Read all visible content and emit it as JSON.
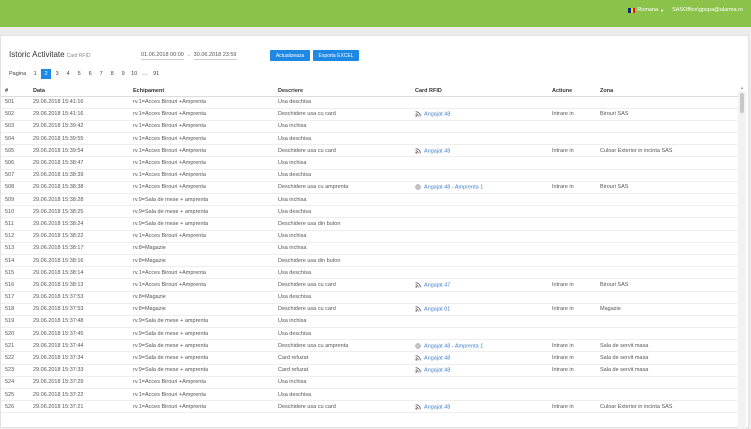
{
  "topbar": {
    "language": "Romana",
    "user": "SASOffice\\gpopa@alarma.ro",
    "flag_colors": [
      "#002B7F",
      "#FCD116",
      "#CE1126"
    ]
  },
  "header": {
    "title": "Istoric Activitate",
    "subtitle": "Card RFID"
  },
  "filters": {
    "date_from": "01.06.2018 00:00",
    "separator": "-",
    "date_to": "30.06.2018 23:59"
  },
  "buttons": {
    "refresh": "Actualizeaza",
    "export": "Exporta EXCEL"
  },
  "pager": {
    "label": "Pagina",
    "pages": [
      "1",
      "2",
      "3",
      "4",
      "5",
      "6",
      "7",
      "8",
      "9",
      "10",
      "...",
      "91"
    ],
    "active_index": 1
  },
  "table": {
    "headers": [
      "#",
      "Data",
      "Echipament",
      "Descriere",
      "Card RFID",
      "Actiune",
      "Zona"
    ],
    "rows": [
      [
        "501",
        "29.06.2018 15:41:16",
        "rv.1=Acces Birouri +Amprenta",
        "Usa deschisa",
        "",
        "",
        ""
      ],
      [
        "502",
        "29.06.2018 15:41:16",
        "rv.1=Acces Birouri +Amprenta",
        "Deschidere usa cu card",
        "Angajat 48",
        "Intrare in",
        "Birouri SAS"
      ],
      [
        "503",
        "29.06.2018 15:39:42",
        "rv.1=Acces Birouri +Amprenta",
        "Usa inchisa",
        "",
        "",
        ""
      ],
      [
        "504",
        "29.06.2018 15:39:55",
        "rv.1=Acces Birouri +Amprenta",
        "Usa deschisa",
        "",
        "",
        ""
      ],
      [
        "505",
        "29.06.2018 15:39:54",
        "rv.1=Acces Birouri +Amprenta",
        "Deschidere usa cu card",
        "Angajat 48",
        "Intrare in",
        "Culoar Exterior in incinta SAS"
      ],
      [
        "506",
        "29.06.2018 15:38:47",
        "rv.1=Acces Birouri +Amprenta",
        "Usa inchisa",
        "",
        "",
        ""
      ],
      [
        "507",
        "29.06.2018 15:38:39",
        "rv.1=Acces Birouri +Amprenta",
        "Usa deschisa",
        "",
        "",
        ""
      ],
      [
        "508",
        "29.06.2018 15:38:38",
        "rv.1=Acces Birouri +Amprenta",
        "Deschidere usa cu amprenta",
        "Angajat 48 - Amprenta 1",
        "Intrare in",
        "Birouri SAS"
      ],
      [
        "509",
        "29.06.2018 15:38:28",
        "rv.9=Sala de mese + amprenta",
        "Usa inchisa",
        "",
        "",
        ""
      ],
      [
        "510",
        "29.06.2018 15:38:25",
        "rv.9=Sala de mese + amprenta",
        "Usa deschisa",
        "",
        "",
        ""
      ],
      [
        "511",
        "29.06.2018 15:38:24",
        "rv.9=Sala de mese + amprenta",
        "Deschidere usa din buton",
        "",
        "",
        ""
      ],
      [
        "512",
        "29.06.2018 15:38:22",
        "rv.1=Acces Birouri +Amprenta",
        "Usa inchisa",
        "",
        "",
        ""
      ],
      [
        "513",
        "29.06.2018 15:38:17",
        "rv.8=Magazie",
        "Usa inchisa",
        "",
        "",
        ""
      ],
      [
        "514",
        "29.06.2018 15:38:16",
        "rv.8=Magazie",
        "Deschidere usa din buton",
        "",
        "",
        ""
      ],
      [
        "515",
        "29.06.2018 15:38:14",
        "rv.1=Acces Birouri +Amprenta",
        "Usa deschisa",
        "",
        "",
        ""
      ],
      [
        "516",
        "29.06.2018 15:38:13",
        "rv.1=Acces Birouri +Amprenta",
        "Deschidere usa cu card",
        "Angajat 47",
        "Intrare in",
        "Birouri SAS"
      ],
      [
        "517",
        "29.06.2018 15:37:53",
        "rv.8=Magazie",
        "Usa deschisa",
        "",
        "",
        ""
      ],
      [
        "518",
        "29.06.2018 15:37:53",
        "rv.8=Magazie",
        "Deschidere usa cu card",
        "Angajat 01",
        "Intrare in",
        "Magazie"
      ],
      [
        "519",
        "29.06.2018 15:37:48",
        "rv.9=Sala de mese + amprenta",
        "Usa inchisa",
        "",
        "",
        ""
      ],
      [
        "520",
        "29.06.2018 15:37:45",
        "rv.9=Sala de mese + amprenta",
        "Usa deschisa",
        "",
        "",
        ""
      ],
      [
        "521",
        "29.06.2018 15:37:44",
        "rv.9=Sala de mese + amprenta",
        "Deschidere usa cu amprenta",
        "Angajat 48 - Amprenta 1",
        "Intrare in",
        "Sala de servit masa"
      ],
      [
        "522",
        "29.06.2018 15:37:34",
        "rv.9=Sala de mese + amprenta",
        "Card refuzat",
        "Angajat 48",
        "Intrare in",
        "Sala de servit masa"
      ],
      [
        "523",
        "29.06.2018 15:37:33",
        "rv.9=Sala de mese + amprenta",
        "Card refuzat",
        "Angajat 48",
        "Intrare in",
        "Sala de servit masa"
      ],
      [
        "524",
        "29.06.2018 15:37:29",
        "rv.1=Acces Birouri +Amprenta",
        "Usa inchisa",
        "",
        "",
        ""
      ],
      [
        "525",
        "29.06.2018 15:37:22",
        "rv.1=Acces Birouri +Amprenta",
        "Usa deschisa",
        "",
        "",
        ""
      ],
      [
        "526",
        "29.06.2018 15:37:21",
        "rv.1=Acces Birouri +Amprenta",
        "Deschidere usa cu card",
        "Angajat 48",
        "Intrare in",
        "Culoar Exterior in incinta SAS"
      ]
    ]
  }
}
